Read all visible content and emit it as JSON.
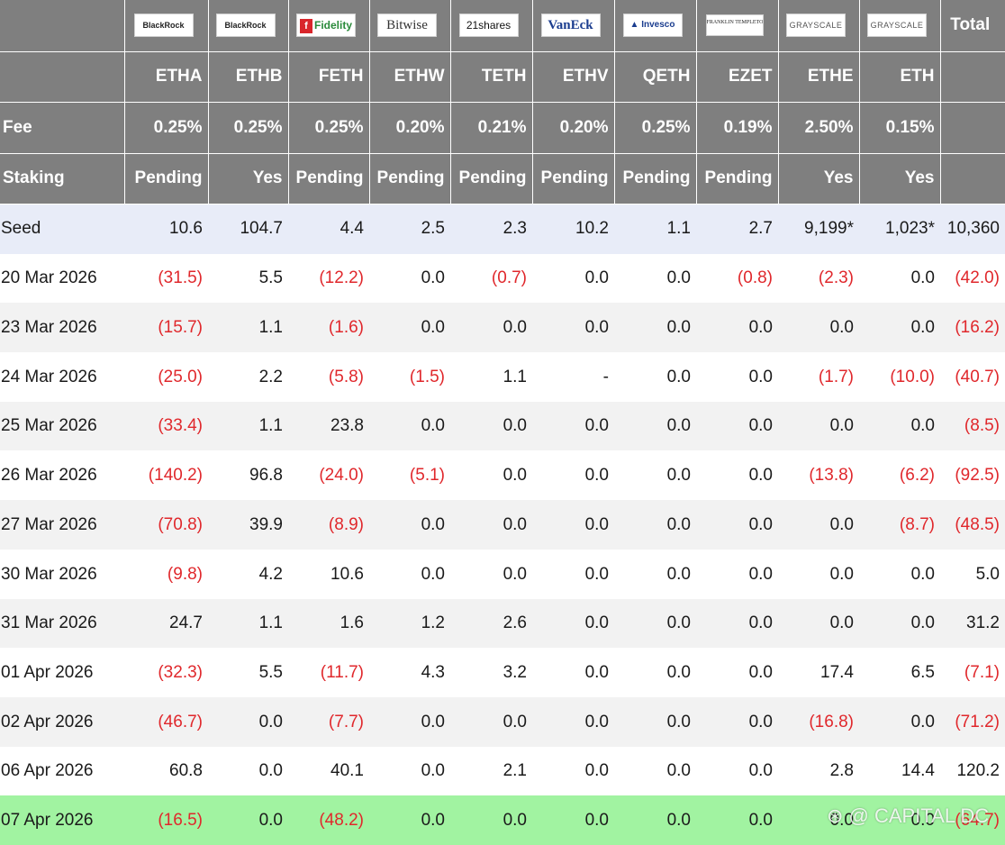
{
  "issuers": [
    "BlackRock",
    "BlackRock",
    "Fidelity",
    "Bitwise",
    "21shares",
    "VanEck",
    "Invesco",
    "FRANKLIN TEMPLETON",
    "GRAYSCALE",
    "GRAYSCALE"
  ],
  "total_label": "Total",
  "tickers": [
    "ETHA",
    "ETHB",
    "FETH",
    "ETHW",
    "TETH",
    "ETHV",
    "QETH",
    "EZET",
    "ETHE",
    "ETH"
  ],
  "fee_label": "Fee",
  "fees": [
    "0.25%",
    "0.25%",
    "0.25%",
    "0.20%",
    "0.21%",
    "0.20%",
    "0.25%",
    "0.19%",
    "2.50%",
    "0.15%"
  ],
  "staking_label": "Staking",
  "staking": [
    "Pending",
    "Yes",
    "Pending",
    "Pending",
    "Pending",
    "Pending",
    "Pending",
    "Pending",
    "Yes",
    "Yes"
  ],
  "rows": [
    {
      "date": "Seed",
      "values": [
        "10.6",
        "104.7",
        "4.4",
        "2.5",
        "2.3",
        "10.2",
        "1.1",
        "2.7",
        "9,199*",
        "1,023*"
      ],
      "total": "10,360"
    },
    {
      "date": "20 Mar 2026",
      "values": [
        "(31.5)",
        "5.5",
        "(12.2)",
        "0.0",
        "(0.7)",
        "0.0",
        "0.0",
        "(0.8)",
        "(2.3)",
        "0.0"
      ],
      "total": "(42.0)"
    },
    {
      "date": "23 Mar 2026",
      "values": [
        "(15.7)",
        "1.1",
        "(1.6)",
        "0.0",
        "0.0",
        "0.0",
        "0.0",
        "0.0",
        "0.0",
        "0.0"
      ],
      "total": "(16.2)"
    },
    {
      "date": "24 Mar 2026",
      "values": [
        "(25.0)",
        "2.2",
        "(5.8)",
        "(1.5)",
        "1.1",
        "-",
        "0.0",
        "0.0",
        "(1.7)",
        "(10.0)"
      ],
      "total": "(40.7)"
    },
    {
      "date": "25 Mar 2026",
      "values": [
        "(33.4)",
        "1.1",
        "23.8",
        "0.0",
        "0.0",
        "0.0",
        "0.0",
        "0.0",
        "0.0",
        "0.0"
      ],
      "total": "(8.5)"
    },
    {
      "date": "26 Mar 2026",
      "values": [
        "(140.2)",
        "96.8",
        "(24.0)",
        "(5.1)",
        "0.0",
        "0.0",
        "0.0",
        "0.0",
        "(13.8)",
        "(6.2)"
      ],
      "total": "(92.5)"
    },
    {
      "date": "27 Mar 2026",
      "values": [
        "(70.8)",
        "39.9",
        "(8.9)",
        "0.0",
        "0.0",
        "0.0",
        "0.0",
        "0.0",
        "0.0",
        "(8.7)"
      ],
      "total": "(48.5)"
    },
    {
      "date": "30 Mar 2026",
      "values": [
        "(9.8)",
        "4.2",
        "10.6",
        "0.0",
        "0.0",
        "0.0",
        "0.0",
        "0.0",
        "0.0",
        "0.0"
      ],
      "total": "5.0"
    },
    {
      "date": "31 Mar 2026",
      "values": [
        "24.7",
        "1.1",
        "1.6",
        "1.2",
        "2.6",
        "0.0",
        "0.0",
        "0.0",
        "0.0",
        "0.0"
      ],
      "total": "31.2"
    },
    {
      "date": "01 Apr 2026",
      "values": [
        "(32.3)",
        "5.5",
        "(11.7)",
        "4.3",
        "3.2",
        "0.0",
        "0.0",
        "0.0",
        "17.4",
        "6.5"
      ],
      "total": "(7.1)"
    },
    {
      "date": "02 Apr 2026",
      "values": [
        "(46.7)",
        "0.0",
        "(7.7)",
        "0.0",
        "0.0",
        "0.0",
        "0.0",
        "0.0",
        "(16.8)",
        "0.0"
      ],
      "total": "(71.2)"
    },
    {
      "date": "06 Apr 2026",
      "values": [
        "60.8",
        "0.0",
        "40.1",
        "0.0",
        "2.1",
        "0.0",
        "0.0",
        "0.0",
        "2.8",
        "14.4"
      ],
      "total": "120.2"
    },
    {
      "date": "07 Apr 2026",
      "values": [
        "(16.5)",
        "0.0",
        "(48.2)",
        "0.0",
        "0.0",
        "0.0",
        "0.0",
        "0.0",
        "0.0",
        "0.0"
      ],
      "total": "(64.7)"
    }
  ],
  "watermark": "CAPITAL DC",
  "colors": {
    "header_bg": "#7f7f7f",
    "negative": "#e0282c",
    "highlight_row": "#a1f3a1",
    "seed_row": "#e8ecf8"
  }
}
